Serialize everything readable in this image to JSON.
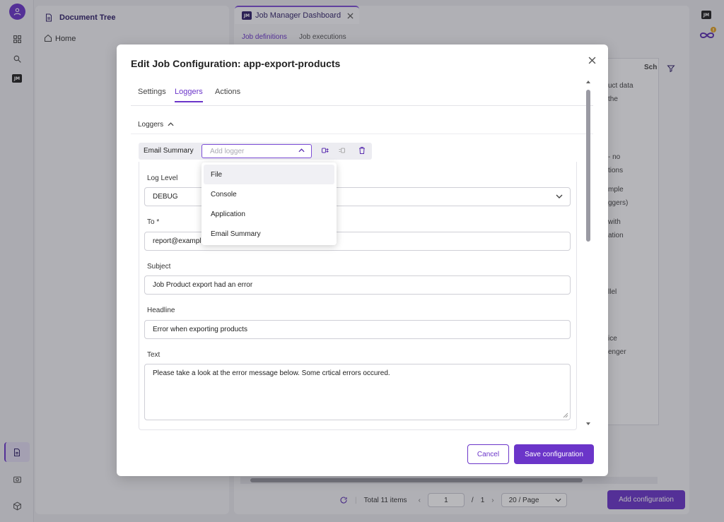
{
  "background": {
    "tree_panel": {
      "title": "Document Tree",
      "home_label": "Home"
    },
    "main_tab": {
      "badge": "JM",
      "title": "Job Manager Dashboard"
    },
    "sub_tabs": [
      "Job definitions",
      "Job executions"
    ],
    "table_header": "Sch",
    "table_fragments": [
      "uct data",
      "the",
      "- no",
      "tions",
      "mple",
      "ggers)",
      "with",
      "ation",
      "llel",
      "ice",
      "enger"
    ],
    "pager": {
      "total": "Total 11 items",
      "page": "1",
      "of": "/",
      "pages": "1",
      "per_page": "20 / Page"
    },
    "add_config_label": "Add configuration",
    "right_badge": "JM"
  },
  "modal": {
    "title": "Edit Job Configuration: app-export-products",
    "tabs": [
      "Settings",
      "Loggers",
      "Actions"
    ],
    "active_tab": "Loggers",
    "section_title": "Loggers",
    "logger": {
      "name": "Email Summary",
      "add_placeholder": "Add logger",
      "options": [
        "File",
        "Console",
        "Application",
        "Email Summary"
      ]
    },
    "fields": {
      "log_level": {
        "label": "Log Level",
        "value": "DEBUG"
      },
      "to": {
        "label": "To *",
        "value": "report@example.com"
      },
      "subject": {
        "label": "Subject",
        "value": "Job Product export had an error"
      },
      "headline": {
        "label": "Headline",
        "value": "Error when exporting products"
      },
      "text": {
        "label": "Text",
        "value": "Please take a look at the error message below. Some crtical errors occured."
      }
    },
    "cancel_label": "Cancel",
    "save_label": "Save configuration"
  },
  "colors": {
    "accent": "#6b35c9",
    "title": "#2e1f67",
    "warning": "#e0a020"
  }
}
